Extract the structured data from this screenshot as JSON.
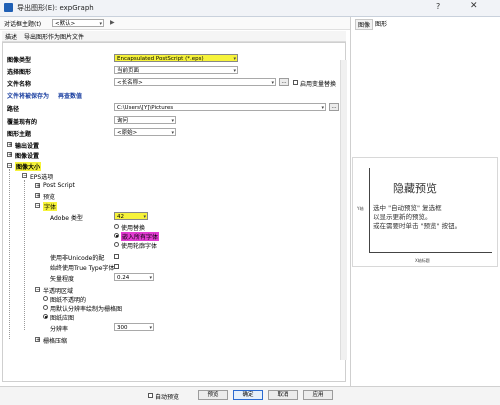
{
  "window": {
    "title": "导出图形(E): expGraph",
    "help_label": "?",
    "close_label": "✕"
  },
  "toolbar": {
    "dialog_theme_label": "对话框主题(t)",
    "dialog_theme_value": "<默认>",
    "arrow_label": "▶"
  },
  "description": {
    "label": "描述",
    "value": "导出图形作为图片文件"
  },
  "form": {
    "image_type_label": "图像类型",
    "image_type_value": "Encapsulated PostScript (*.eps)",
    "select_graph_label": "选择图形",
    "select_graph_value": "当前页面",
    "file_name_label": "文件名称",
    "file_name_value": "<长名称>",
    "file_name_btn": "...",
    "enable_var_label": "启用变量替换",
    "file_save_label": "文件将被保存为",
    "recalc_label": "再查数值",
    "path_label": "路径",
    "path_value": "C:\\Users\\[Y]\\Pictures",
    "path_btn": "...",
    "overwrite_label": "覆盖现有的",
    "overwrite_value": "询问",
    "graph_theme_label": "图形主题",
    "graph_theme_value": "<原始>",
    "output_settings_label": "输出设置",
    "image_settings_label": "图像设置",
    "image_size_label": "图像大小"
  },
  "eps": {
    "options_label": "EPS选项",
    "postscript_label": "Post Script",
    "preview_label": "预览",
    "font_label": "字体",
    "adobe_type_label": "Adobe 类型",
    "adobe_type_value": "42",
    "use_replace": "使用替换",
    "embed_font": "嵌入所有字体",
    "use_outline": "使用轮廓字体",
    "use_unicode": "使用非Unicode的配",
    "always_truetype": "始终使用True Type字体",
    "vector_level_label": "矢量程度",
    "vector_level_value": "0.24",
    "transparency_label": "半透明区域",
    "trans_opt1": "图纸不透明的",
    "trans_opt2": "用默认分辨率绘制为栅格图",
    "trans_opt3": "图纸应图",
    "resolution_label": "分辨率",
    "resolution_value": "300",
    "clip_path_label": "栅格压缩"
  },
  "right": {
    "tab_image": "图像",
    "tab_graph": "图形",
    "preview_title": "隐藏预览",
    "preview_line1": "选中 \"自动预览\" 复选框",
    "preview_line2": "以显示更新的预览。",
    "preview_line3": "或在需要时单击 \"预览\" 按钮。",
    "axis_x_label": "X轴标题",
    "axis_y_label": "Y轴"
  },
  "buttons": {
    "auto_preview": "自动预览",
    "preview": "预览",
    "ok": "确定",
    "cancel": "取消",
    "apply": "应用"
  },
  "colors": {
    "highlight_yellow": "#f6f33a",
    "highlight_magenta": "#e23bd2",
    "accent_blue": "#1a3fa0"
  }
}
